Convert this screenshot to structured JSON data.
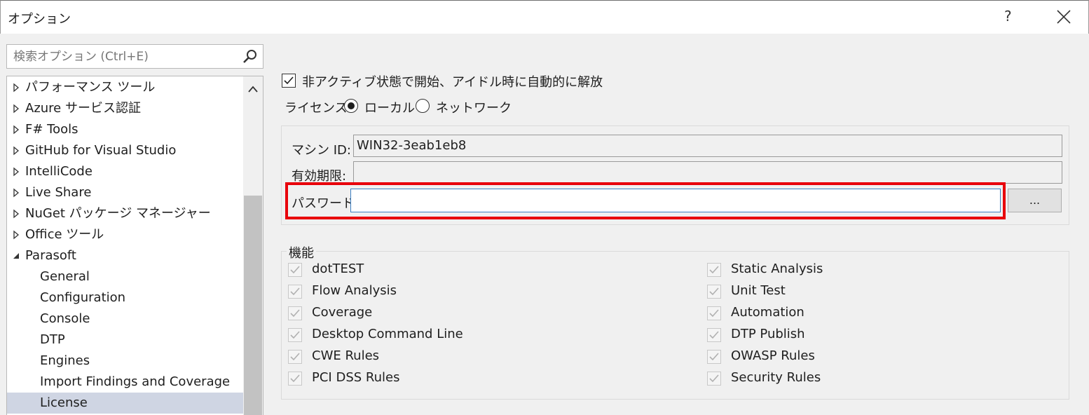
{
  "window": {
    "title": "オプション",
    "help_label": "?",
    "close_icon": "close-icon"
  },
  "search": {
    "placeholder": "検索オプション (Ctrl+E)",
    "value": "",
    "icon": "search-icon"
  },
  "tree": {
    "items": [
      {
        "label": "パフォーマンス ツール",
        "expanded": false,
        "level": 0
      },
      {
        "label": "Azure サービス認証",
        "expanded": false,
        "level": 0
      },
      {
        "label": "F# Tools",
        "expanded": false,
        "level": 0
      },
      {
        "label": "GitHub for Visual Studio",
        "expanded": false,
        "level": 0
      },
      {
        "label": "IntelliCode",
        "expanded": false,
        "level": 0
      },
      {
        "label": "Live Share",
        "expanded": false,
        "level": 0
      },
      {
        "label": "NuGet パッケージ マネージャー",
        "expanded": false,
        "level": 0
      },
      {
        "label": "Office ツール",
        "expanded": false,
        "level": 0
      },
      {
        "label": "Parasoft",
        "expanded": true,
        "level": 0
      },
      {
        "label": "General",
        "level": 1
      },
      {
        "label": "Configuration",
        "level": 1
      },
      {
        "label": "Console",
        "level": 1
      },
      {
        "label": "DTP",
        "level": 1
      },
      {
        "label": "Engines",
        "level": 1
      },
      {
        "label": "Import Findings and Coverage",
        "level": 1
      },
      {
        "label": "License",
        "level": 1,
        "selected": true
      }
    ]
  },
  "options": {
    "auto_release_label": "非アクティブ状態で開始、アイドル時に自動的に解放",
    "auto_release_checked": true,
    "license_label": "ライセンス",
    "local_label": "ローカル",
    "network_label": "ネットワーク",
    "license_mode": "local"
  },
  "license_group": {
    "machine_id_label": "マシン ID:",
    "machine_id_value": "WIN32-3eab1eb8",
    "expiry_label": "有効期限:",
    "expiry_value": "",
    "password_label": "パスワード:",
    "password_value": "",
    "browse_button_label": "...",
    "highlight_color": "#e8000b"
  },
  "features": {
    "title": "機能",
    "left": [
      "dotTEST",
      "Flow Analysis",
      "Coverage",
      "Desktop Command Line",
      "CWE Rules",
      "PCI DSS Rules"
    ],
    "right": [
      "Static Analysis",
      "Unit Test",
      "Automation",
      "DTP Publish",
      "OWASP Rules",
      "Security Rules"
    ]
  }
}
